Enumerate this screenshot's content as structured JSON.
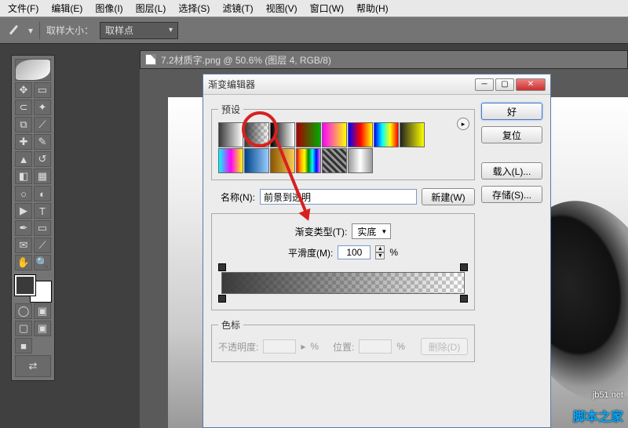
{
  "menu": {
    "file": "文件(F)",
    "edit": "编辑(E)",
    "image": "图像(I)",
    "layer": "图层(L)",
    "select": "选择(S)",
    "filter": "滤镜(T)",
    "view": "视图(V)",
    "window": "窗口(W)",
    "help": "帮助(H)"
  },
  "options": {
    "sample_label": "取样大小：",
    "sample_value": "取样点"
  },
  "doc": {
    "title": "7.2材质字.png @ 50.6% (图层 4, RGB/8)"
  },
  "dialog": {
    "title": "渐变编辑器",
    "presets_legend": "预设",
    "ok": "好",
    "reset": "复位",
    "load": "载入(L)...",
    "save": "存储(S)...",
    "new": "新建(W)",
    "name_label": "名称(N):",
    "name_value": "前景到透明",
    "type_label": "渐变类型(T):",
    "type_value": "实底",
    "smooth_label": "平滑度(M):",
    "smooth_value": "100",
    "pct": "%",
    "stops_legend": "色标",
    "opacity_label": "不透明度:",
    "pos_label": "位置:",
    "delete": "删除(D)"
  },
  "watermark": {
    "url": "jb51.net",
    "text": "脚本之家"
  }
}
